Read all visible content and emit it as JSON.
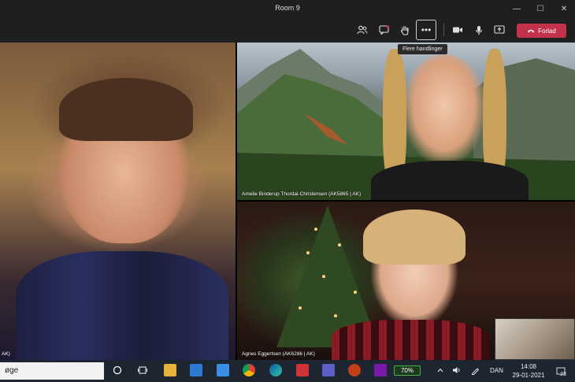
{
  "window": {
    "title": "Room 9",
    "minimize": "—",
    "maximize": "☐",
    "close": "✕"
  },
  "toolbar": {
    "participants_icon": "people-icon",
    "chat_icon": "chat-icon",
    "raise_hand_icon": "raise-hand-icon",
    "more_label": "•••",
    "more_tooltip": "Flere handlinger",
    "camera_icon": "camera-icon",
    "mic_icon": "microphone-icon",
    "share_icon": "share-screen-icon",
    "leave_label": "Forlad",
    "leave_color": "#c4314b"
  },
  "participants": {
    "left_label": "AK)",
    "top_right_name": "Amelie Binderup Thordal-Christensen (AK5865 | AK)",
    "bottom_right_name": "Agnes Eggertsen (AK6286 | AK)"
  },
  "taskbar": {
    "search_text": "øge",
    "battery_text": "70%",
    "keyboard_lang": "DAN",
    "time": "14:08",
    "date": "29-01-2021",
    "notifications": "23"
  }
}
